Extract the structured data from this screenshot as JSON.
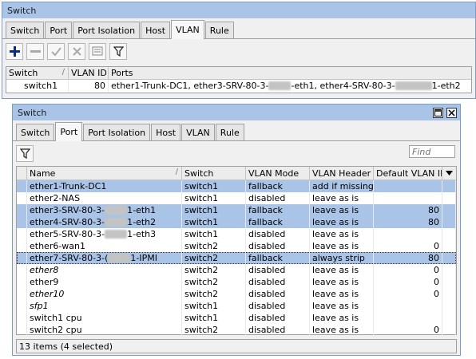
{
  "win1": {
    "title": "Switch",
    "tabs": [
      "Switch",
      "Port",
      "Port Isolation",
      "Host",
      "VLAN",
      "Rule"
    ],
    "active_tab": "VLAN",
    "columns": [
      "Switch",
      "VLAN ID",
      "Ports"
    ],
    "row": {
      "switch": "switch1",
      "vlan_id": "80",
      "ports_a": "ether1-Trunk-DC1, ether3-SRV-80-3-",
      "ports_b": "-eth1, ether4-SRV-80-3-",
      "ports_c": "1-eth2"
    }
  },
  "win2": {
    "title": "Switch",
    "tabs": [
      "Switch",
      "Port",
      "Port Isolation",
      "Host",
      "VLAN",
      "Rule"
    ],
    "active_tab": "Port",
    "find_placeholder": "Find",
    "columns": [
      "Name",
      "Switch",
      "VLAN Mode",
      "VLAN Header",
      "Default VLAN ID"
    ],
    "rows": [
      {
        "pre": "ether1-Trunk-DC1",
        "suf": "",
        "blur": false,
        "italic": false,
        "selected": true,
        "focused": false,
        "switch": "switch1",
        "mode": "fallback",
        "header": "add if missing",
        "default_vlan_id": ""
      },
      {
        "pre": "ether2-NAS",
        "suf": "",
        "blur": false,
        "italic": false,
        "selected": false,
        "focused": false,
        "switch": "switch1",
        "mode": "disabled",
        "header": "leave as is",
        "default_vlan_id": ""
      },
      {
        "pre": "ether3-SRV-80-3-",
        "suf": "1-eth1",
        "blur": true,
        "italic": false,
        "selected": true,
        "focused": false,
        "switch": "switch1",
        "mode": "fallback",
        "header": "leave as is",
        "default_vlan_id": "80"
      },
      {
        "pre": "ether4-SRV-80-3-",
        "suf": "1-eth2",
        "blur": true,
        "italic": false,
        "selected": true,
        "focused": false,
        "switch": "switch1",
        "mode": "fallback",
        "header": "leave as is",
        "default_vlan_id": "80"
      },
      {
        "pre": "ether5-SRV-80-3-",
        "suf": "1-eth3",
        "blur": true,
        "italic": false,
        "selected": false,
        "focused": false,
        "switch": "switch1",
        "mode": "disabled",
        "header": "leave as is",
        "default_vlan_id": ""
      },
      {
        "pre": "ether6-wan1",
        "suf": "",
        "blur": false,
        "italic": false,
        "selected": false,
        "focused": false,
        "switch": "switch2",
        "mode": "disabled",
        "header": "leave as is",
        "default_vlan_id": "0"
      },
      {
        "pre": "ether7-SRV-80-3-(",
        "suf": "1-IPMI",
        "blur": true,
        "italic": false,
        "selected": true,
        "focused": true,
        "switch": "switch2",
        "mode": "fallback",
        "header": "always strip",
        "default_vlan_id": "80"
      },
      {
        "pre": "ether8",
        "suf": "",
        "blur": false,
        "italic": true,
        "selected": false,
        "focused": false,
        "switch": "switch2",
        "mode": "disabled",
        "header": "leave as is",
        "default_vlan_id": "0"
      },
      {
        "pre": "ether9",
        "suf": "",
        "blur": false,
        "italic": false,
        "selected": false,
        "focused": false,
        "switch": "switch2",
        "mode": "disabled",
        "header": "leave as is",
        "default_vlan_id": "0"
      },
      {
        "pre": "ether10",
        "suf": "",
        "blur": false,
        "italic": true,
        "selected": false,
        "focused": false,
        "switch": "switch2",
        "mode": "disabled",
        "header": "leave as is",
        "default_vlan_id": "0"
      },
      {
        "pre": "sfp1",
        "suf": "",
        "blur": false,
        "italic": true,
        "selected": false,
        "focused": false,
        "switch": "switch1",
        "mode": "disabled",
        "header": "leave as is",
        "default_vlan_id": ""
      },
      {
        "pre": "switch1 cpu",
        "suf": "",
        "blur": false,
        "italic": false,
        "selected": false,
        "focused": false,
        "switch": "switch1",
        "mode": "disabled",
        "header": "leave as is",
        "default_vlan_id": ""
      },
      {
        "pre": "switch2 cpu",
        "suf": "",
        "blur": false,
        "italic": false,
        "selected": false,
        "focused": false,
        "switch": "switch2",
        "mode": "disabled",
        "header": "leave as is",
        "default_vlan_id": "0"
      }
    ],
    "status": "13 items (4 selected)"
  },
  "icons": [
    "add-icon",
    "remove-icon",
    "enable-icon",
    "disable-icon",
    "comment-icon",
    "filter-icon",
    "maximize-icon",
    "close-icon"
  ],
  "colors": {
    "titlebar": "#a9c4e6",
    "selection": "#a9c4e6",
    "accent": "#0b2a8a"
  }
}
